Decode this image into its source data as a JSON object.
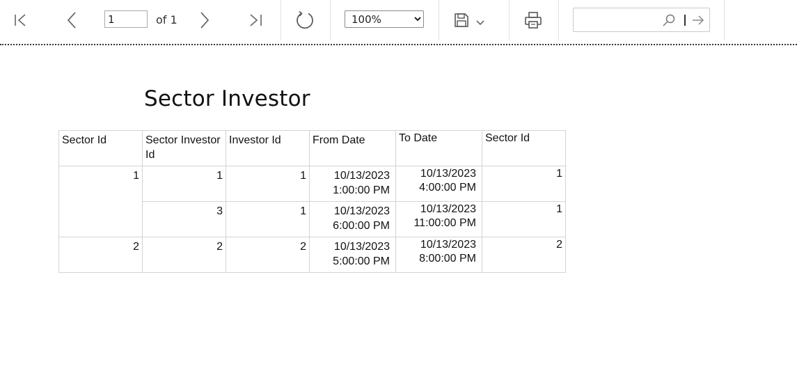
{
  "toolbar": {
    "current_page": "1",
    "page_count_label": "of 1",
    "zoom": "100%",
    "zoom_options": [
      "100%"
    ],
    "search_placeholder": ""
  },
  "report": {
    "title": "Sector Investor",
    "columns": [
      "Sector Id",
      "Sector Investor Id",
      "Investor Id",
      "From Date",
      "To Date",
      "Sector Id"
    ],
    "rows": [
      {
        "sector_id": "1",
        "sector_investor_id": "1",
        "investor_id": "1",
        "from_date_1": "10/13/2023",
        "from_date_2": "1:00:00 PM",
        "to_date_1": "10/13/2023",
        "to_date_2": "4:00:00 PM",
        "sector_id_2": "1"
      },
      {
        "sector_id": "",
        "sector_investor_id": "3",
        "investor_id": "1",
        "from_date_1": "10/13/2023",
        "from_date_2": "6:00:00 PM",
        "to_date_1": "10/13/2023",
        "to_date_2": "11:00:00 PM",
        "sector_id_2": "1"
      },
      {
        "sector_id": "2",
        "sector_investor_id": "2",
        "investor_id": "2",
        "from_date_1": "10/13/2023",
        "from_date_2": "5:00:00 PM",
        "to_date_1": "10/13/2023",
        "to_date_2": "8:00:00 PM",
        "sector_id_2": "2"
      }
    ]
  }
}
